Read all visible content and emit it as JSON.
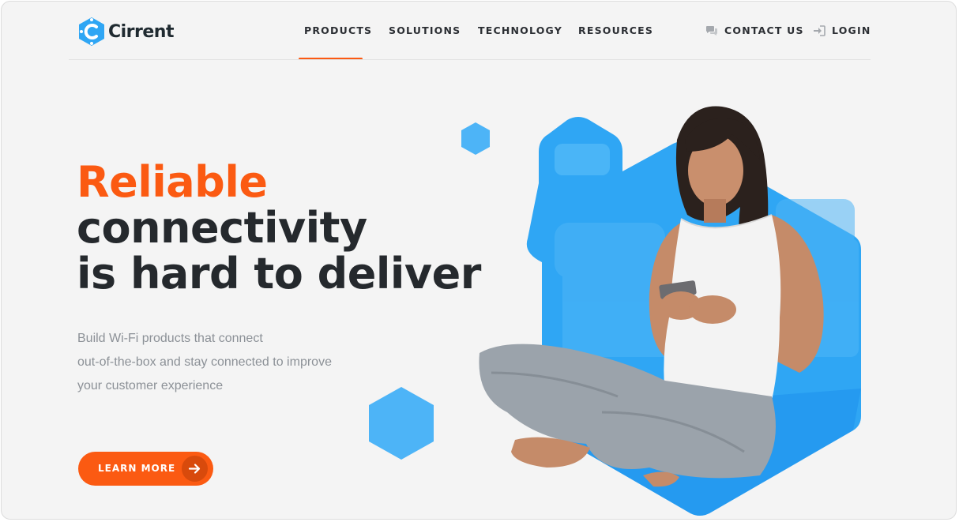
{
  "brand": {
    "name": "Cirrent",
    "logo_icon": "hexagon-c-logo",
    "accent_color": "#fb5a12",
    "secondary_color": "#2fa6f4"
  },
  "nav": {
    "items": [
      {
        "label": "PRODUCTS",
        "active": true
      },
      {
        "label": "SOLUTIONS",
        "active": false
      },
      {
        "label": "TECHNOLOGY",
        "active": false
      },
      {
        "label": "RESOURCES",
        "active": false
      }
    ],
    "contact": {
      "label": "CONTACT US",
      "icon": "chat-bubbles-icon"
    },
    "login": {
      "label": "LOGIN",
      "icon": "sign-in-icon"
    }
  },
  "hero": {
    "headline_accent": "Reliable",
    "headline_line2": "connectivity",
    "headline_line3": "is hard to deliver",
    "subtitle_lines": [
      "Build Wi-Fi products that connect",
      "out-of-the-box and stay connected to improve",
      "your customer experience"
    ],
    "cta": {
      "label": "LEARN MORE",
      "icon": "arrow-right-icon"
    },
    "image_icon": "woman-with-smartphone-illustration"
  }
}
